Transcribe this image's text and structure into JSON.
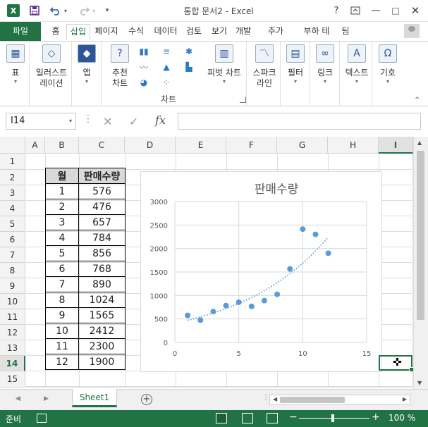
{
  "window": {
    "title": "통합 문서2 - Excel",
    "app_logo": "X",
    "help": "?",
    "controls": {
      "minimize": "—",
      "maximize": "□",
      "close": "✕"
    }
  },
  "qat": {
    "save_icon": "save-icon",
    "undo_icon": "undo-icon",
    "redo_icon": "redo-icon"
  },
  "tabs": [
    "파일",
    "홈",
    "삽입",
    "페이지",
    "수식",
    "데이터",
    "검토",
    "보기",
    "개발",
    "추가",
    "부하 테",
    "팀"
  ],
  "active_tab": "삽입",
  "ribbon": {
    "table": "표",
    "illustrations": "일러스트\n레이션",
    "illustrations_l1": "일러스트",
    "illustrations_l2": "레이션",
    "addins": "앱",
    "recommended_l1": "추천",
    "recommended_l2": "차트",
    "pivot_chart": "피벗 차트",
    "sparkline_l1": "스파크",
    "sparkline_l2": "라인",
    "filter": "필터",
    "link": "링크",
    "text": "텍스트",
    "symbol": "기호",
    "chart_group": "차트"
  },
  "formula_bar": {
    "name_box": "I14",
    "fx": "fx",
    "value": ""
  },
  "columns": [
    "A",
    "B",
    "C",
    "D",
    "E",
    "F",
    "G",
    "H",
    "I"
  ],
  "selected_column": "I",
  "rows": [
    "1",
    "2",
    "3",
    "4",
    "5",
    "6",
    "7",
    "8",
    "9",
    "10",
    "11",
    "12",
    "13",
    "14",
    "15"
  ],
  "selected_row": "14",
  "table": {
    "headers": [
      "월",
      "판매수량"
    ],
    "rows": [
      [
        "1",
        "576"
      ],
      [
        "2",
        "476"
      ],
      [
        "3",
        "657"
      ],
      [
        "4",
        "784"
      ],
      [
        "5",
        "856"
      ],
      [
        "6",
        "768"
      ],
      [
        "7",
        "890"
      ],
      [
        "8",
        "1024"
      ],
      [
        "9",
        "1565"
      ],
      [
        "10",
        "2412"
      ],
      [
        "11",
        "2300"
      ],
      [
        "12",
        "1900"
      ]
    ]
  },
  "chart_data": {
    "type": "scatter",
    "title": "판매수량",
    "x": [
      1,
      2,
      3,
      4,
      5,
      6,
      7,
      8,
      9,
      10,
      11,
      12
    ],
    "y": [
      576,
      476,
      657,
      784,
      856,
      768,
      890,
      1024,
      1565,
      2412,
      2300,
      1900
    ],
    "xlim": [
      0,
      15
    ],
    "ylim": [
      0,
      3000
    ],
    "xticks": [
      0,
      5,
      10,
      15
    ],
    "yticks": [
      0,
      500,
      1000,
      1500,
      2000,
      2500,
      3000
    ],
    "trendline": "exponential",
    "grid": true,
    "color": "#5b9bd5"
  },
  "sheets": [
    "Sheet1"
  ],
  "status": {
    "ready": "준비",
    "zoom": "100 %"
  }
}
